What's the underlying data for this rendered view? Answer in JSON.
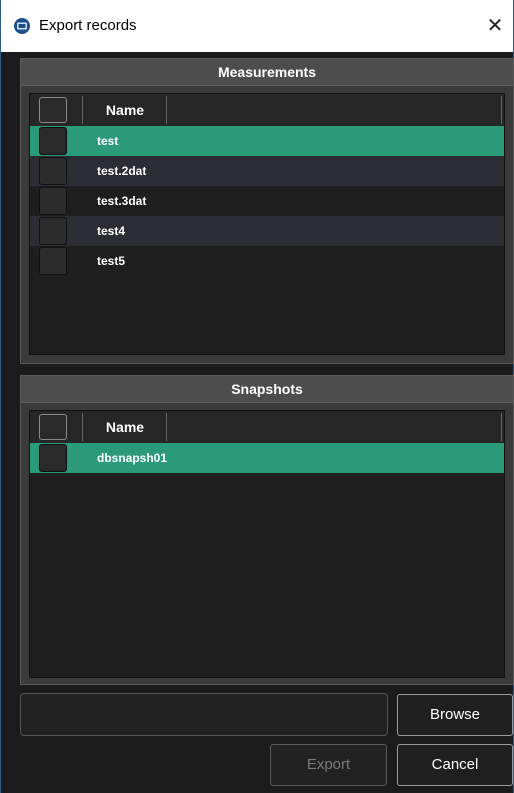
{
  "window": {
    "title": "Export records",
    "close_glyph": "✕",
    "app_icon": "record-app-icon"
  },
  "measurements": {
    "header": "Measurements",
    "column_name": "Name",
    "rows": [
      {
        "name": "test",
        "selected": true
      },
      {
        "name": "test.2dat",
        "selected": false
      },
      {
        "name": "test.3dat",
        "selected": false
      },
      {
        "name": "test4",
        "selected": false
      },
      {
        "name": "test5",
        "selected": false
      }
    ]
  },
  "snapshots": {
    "header": "Snapshots",
    "column_name": "Name",
    "rows": [
      {
        "name": "dbsnapsh01",
        "selected": true
      }
    ]
  },
  "footer": {
    "path_value": "",
    "browse_label": "Browse",
    "export_label": "Export",
    "cancel_label": "Cancel"
  },
  "colors": {
    "selection": "#2a9a79",
    "background": "#1b1b1b",
    "panel": "#3a3a3a"
  }
}
